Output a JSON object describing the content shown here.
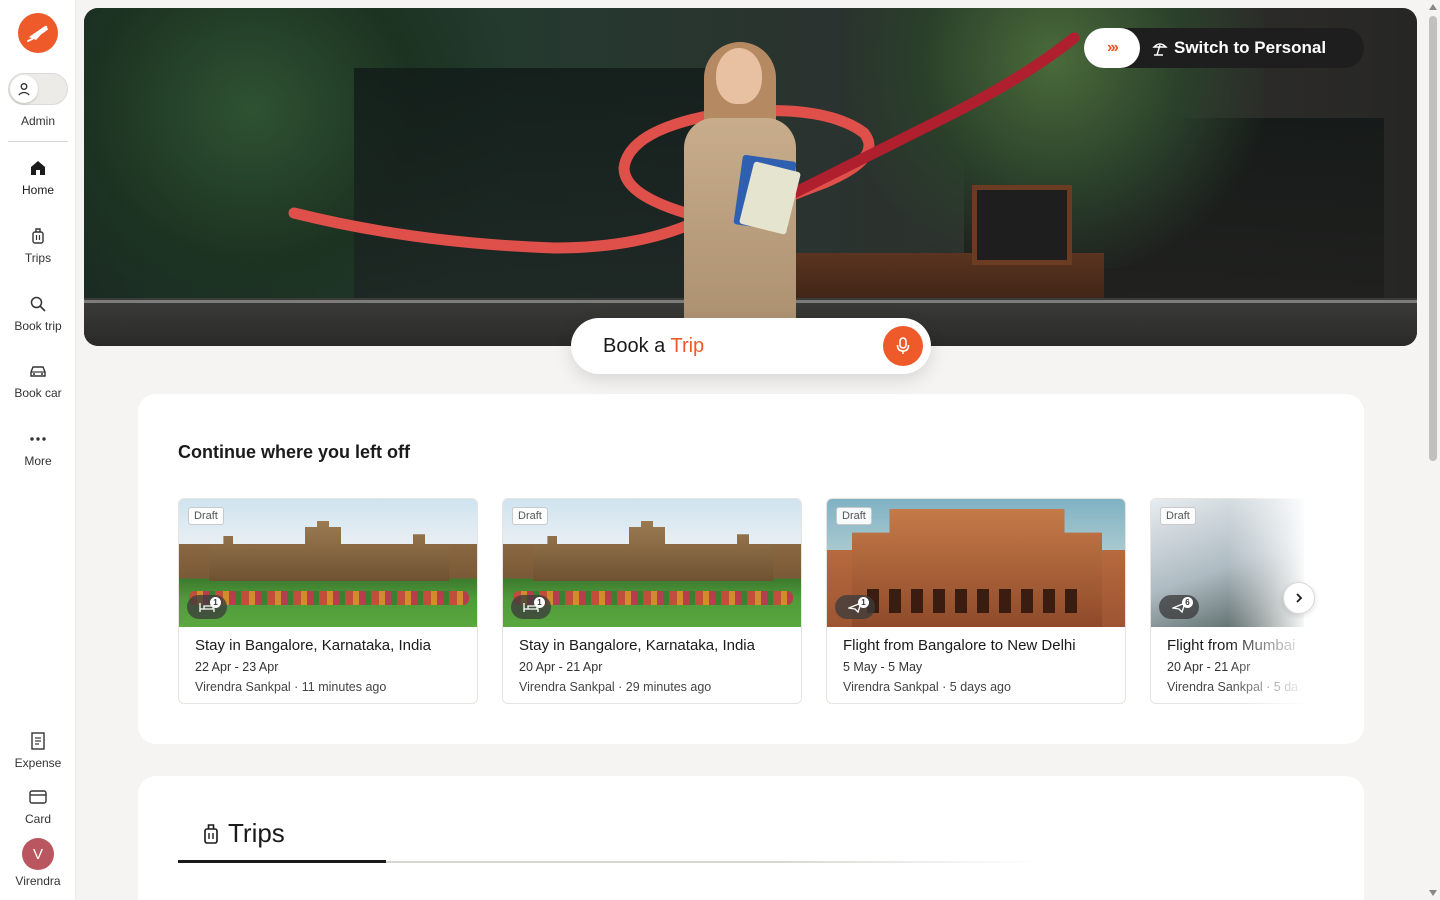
{
  "sidebar": {
    "account_label": "Admin",
    "nav": [
      {
        "label": "Home",
        "icon": "home-icon"
      },
      {
        "label": "Trips",
        "icon": "luggage-icon"
      },
      {
        "label": "Book trip",
        "icon": "search-icon"
      },
      {
        "label": "Book car",
        "icon": "car-icon"
      },
      {
        "label": "More",
        "icon": "more-dots-icon"
      }
    ],
    "bottom": [
      {
        "label": "Expense",
        "icon": "receipt-icon"
      },
      {
        "label": "Card",
        "icon": "credit-card-icon"
      }
    ],
    "user": {
      "initial": "V",
      "name": "Virendra"
    }
  },
  "hero": {
    "switch_label": "Switch to Personal",
    "switch_arrows": "›››",
    "book_prefix": "Book a ",
    "book_accent": "Trip"
  },
  "continue_section": {
    "title": "Continue where you left off",
    "cards": [
      {
        "badge": "Draft",
        "type": "hotel",
        "count": "1",
        "title": "Stay in Bangalore, Karnataka, India",
        "dates": "22 Apr - 23 Apr",
        "meta": "Virendra Sankpal · 11 minutes ago"
      },
      {
        "badge": "Draft",
        "type": "hotel",
        "count": "1",
        "title": "Stay in Bangalore, Karnataka, India",
        "dates": "20 Apr - 21 Apr",
        "meta": "Virendra Sankpal · 29 minutes ago"
      },
      {
        "badge": "Draft",
        "type": "flight",
        "count": "1",
        "title": "Flight from Bangalore to New Delhi",
        "dates": "5 May - 5 May",
        "meta": "Virendra Sankpal · 5 days ago"
      },
      {
        "badge": "Draft",
        "type": "flight",
        "count": "6",
        "title": "Flight from Mumbai",
        "dates": "20 Apr - 21 Apr",
        "meta": "Virendra Sankpal · 5 da"
      }
    ]
  },
  "trips_section": {
    "tab_label": "Trips"
  },
  "colors": {
    "accent": "#ee5a2a",
    "background": "#f5f4f2",
    "avatar": "#b9565f"
  }
}
